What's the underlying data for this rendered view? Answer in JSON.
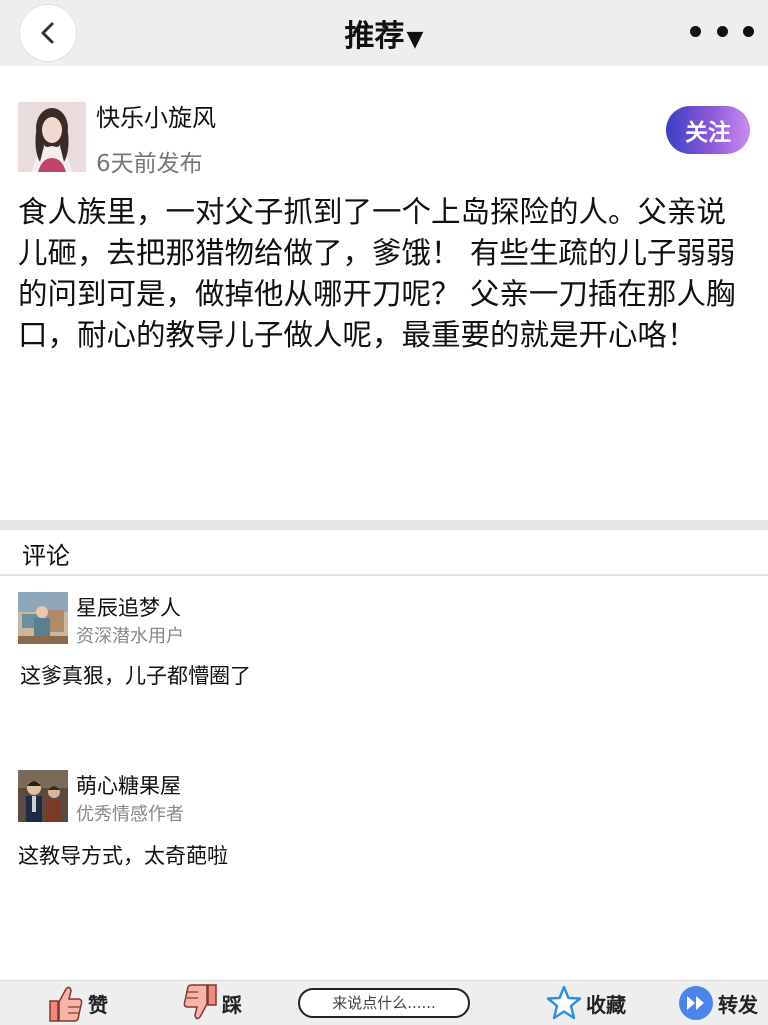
{
  "header": {
    "title": "推荐",
    "caret": "▼"
  },
  "post": {
    "author": "快乐小旋风",
    "time": "6天前发布",
    "follow_label": "关注",
    "body": "食人族里，一对父子抓到了一个上岛探险的人。父亲说儿砸，去把那猎物给做了，爹饿！ 有些生疏的儿子弱弱的问到可是，做掉他从哪开刀呢？ 父亲一刀插在那人胸口，耐心的教导儿子做人呢，最重要的就是开心咯！"
  },
  "comments_section": {
    "title": "评论",
    "items": [
      {
        "name": "星辰追梦人",
        "role": "资深潜水用户",
        "text": "这爹真狠，儿子都懵圈了"
      },
      {
        "name": "萌心糖果屋",
        "role": "优秀情感作者",
        "text": "这教导方式，太奇葩啦"
      }
    ]
  },
  "bottom_bar": {
    "like_label": "赞",
    "dislike_label": "踩",
    "input_placeholder": "来说点什么......",
    "favorite_label": "收藏",
    "share_label": "转发"
  },
  "colors": {
    "follow_gradient_start": "#3b3fc4",
    "follow_gradient_end": "#c98cf0",
    "header_bg": "#eeeeee",
    "like_icon": "#f08a7a",
    "favorite_icon": "#2f8fe0",
    "share_icon": "#4a86e8"
  }
}
